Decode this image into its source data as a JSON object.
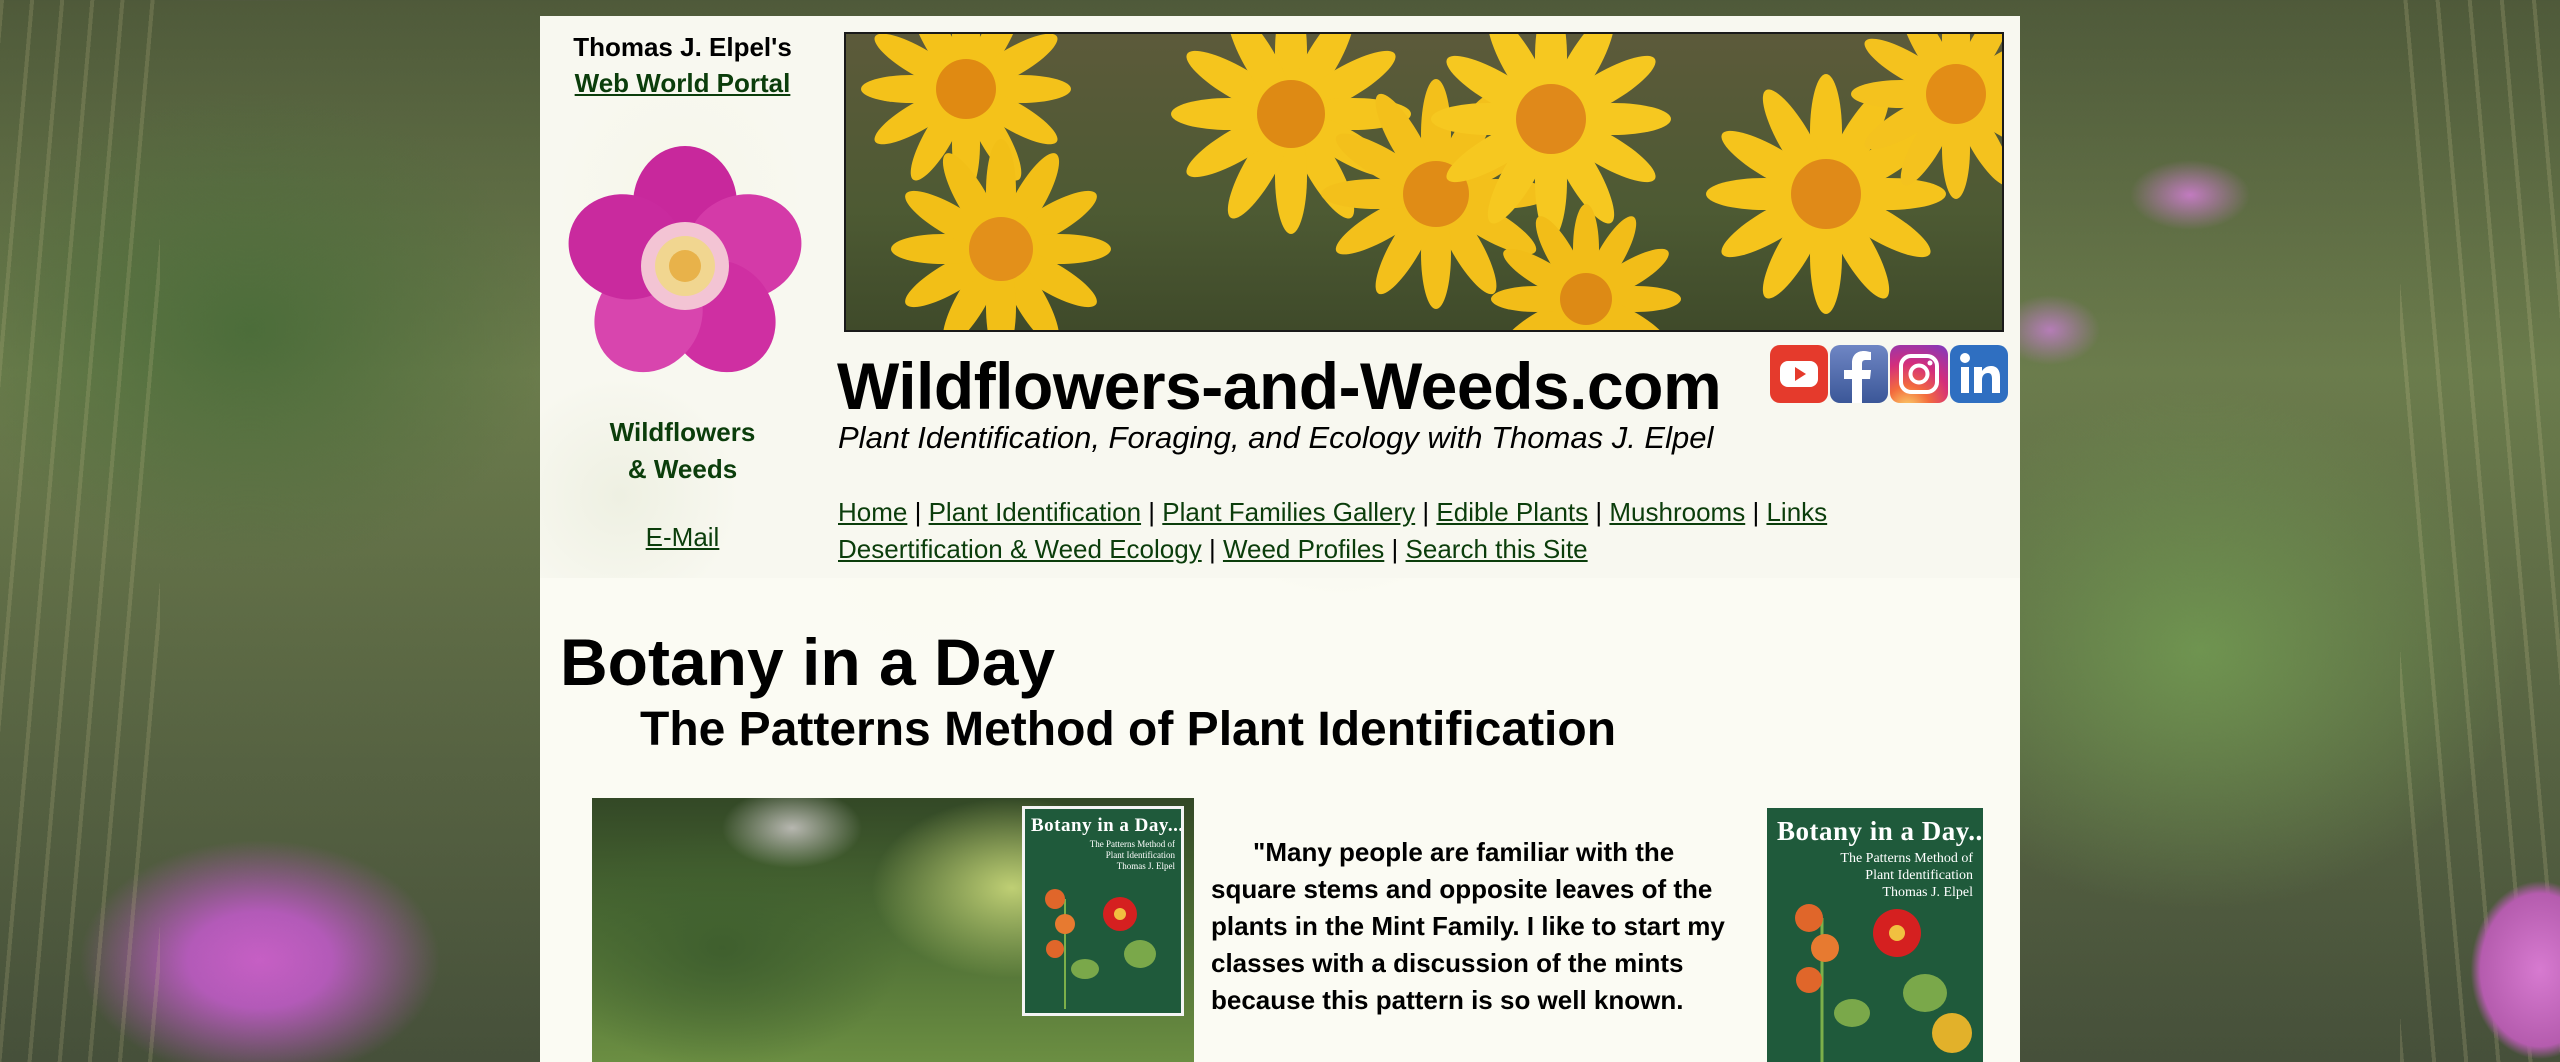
{
  "sidebar": {
    "portal_name": "Thomas J. Elpel's",
    "portal_link": "Web World Portal",
    "brand_line1": "Wildflowers",
    "brand_line2": "& Weeds",
    "email": "E-Mail"
  },
  "header": {
    "title": "Wildflowers-and-Weeds.com",
    "tagline": "Plant Identification, Foraging, and Ecology with Thomas J. Elpel",
    "social": [
      "youtube-icon",
      "facebook-icon",
      "instagram-icon",
      "linkedin-icon"
    ]
  },
  "nav": {
    "row1": [
      "Home",
      "Plant Identification",
      "Plant Families Gallery",
      "Edible Plants",
      "Mushrooms",
      "Links"
    ],
    "row2": [
      "Desertification & Weed Ecology",
      "Weed Profiles",
      "Search this Site"
    ],
    "separator": "|"
  },
  "main": {
    "heading": "Botany in a Day",
    "subheading": "The Patterns Method of Plant Identification",
    "quote": "\"Many people are familiar with the square stems and opposite leaves of the plants in the Mint Family. I like to start my classes with a discussion of the mints because this pattern is so well known.",
    "book_cover": {
      "title": "Botany in a Day...",
      "subtitle": [
        "The Patterns Method of",
        "Plant Identification",
        "Thomas J. Elpel"
      ]
    }
  },
  "colors": {
    "link": "#0b3d0b",
    "page_bg": "#fbfbf3",
    "book_green": "#1f5a3b"
  }
}
